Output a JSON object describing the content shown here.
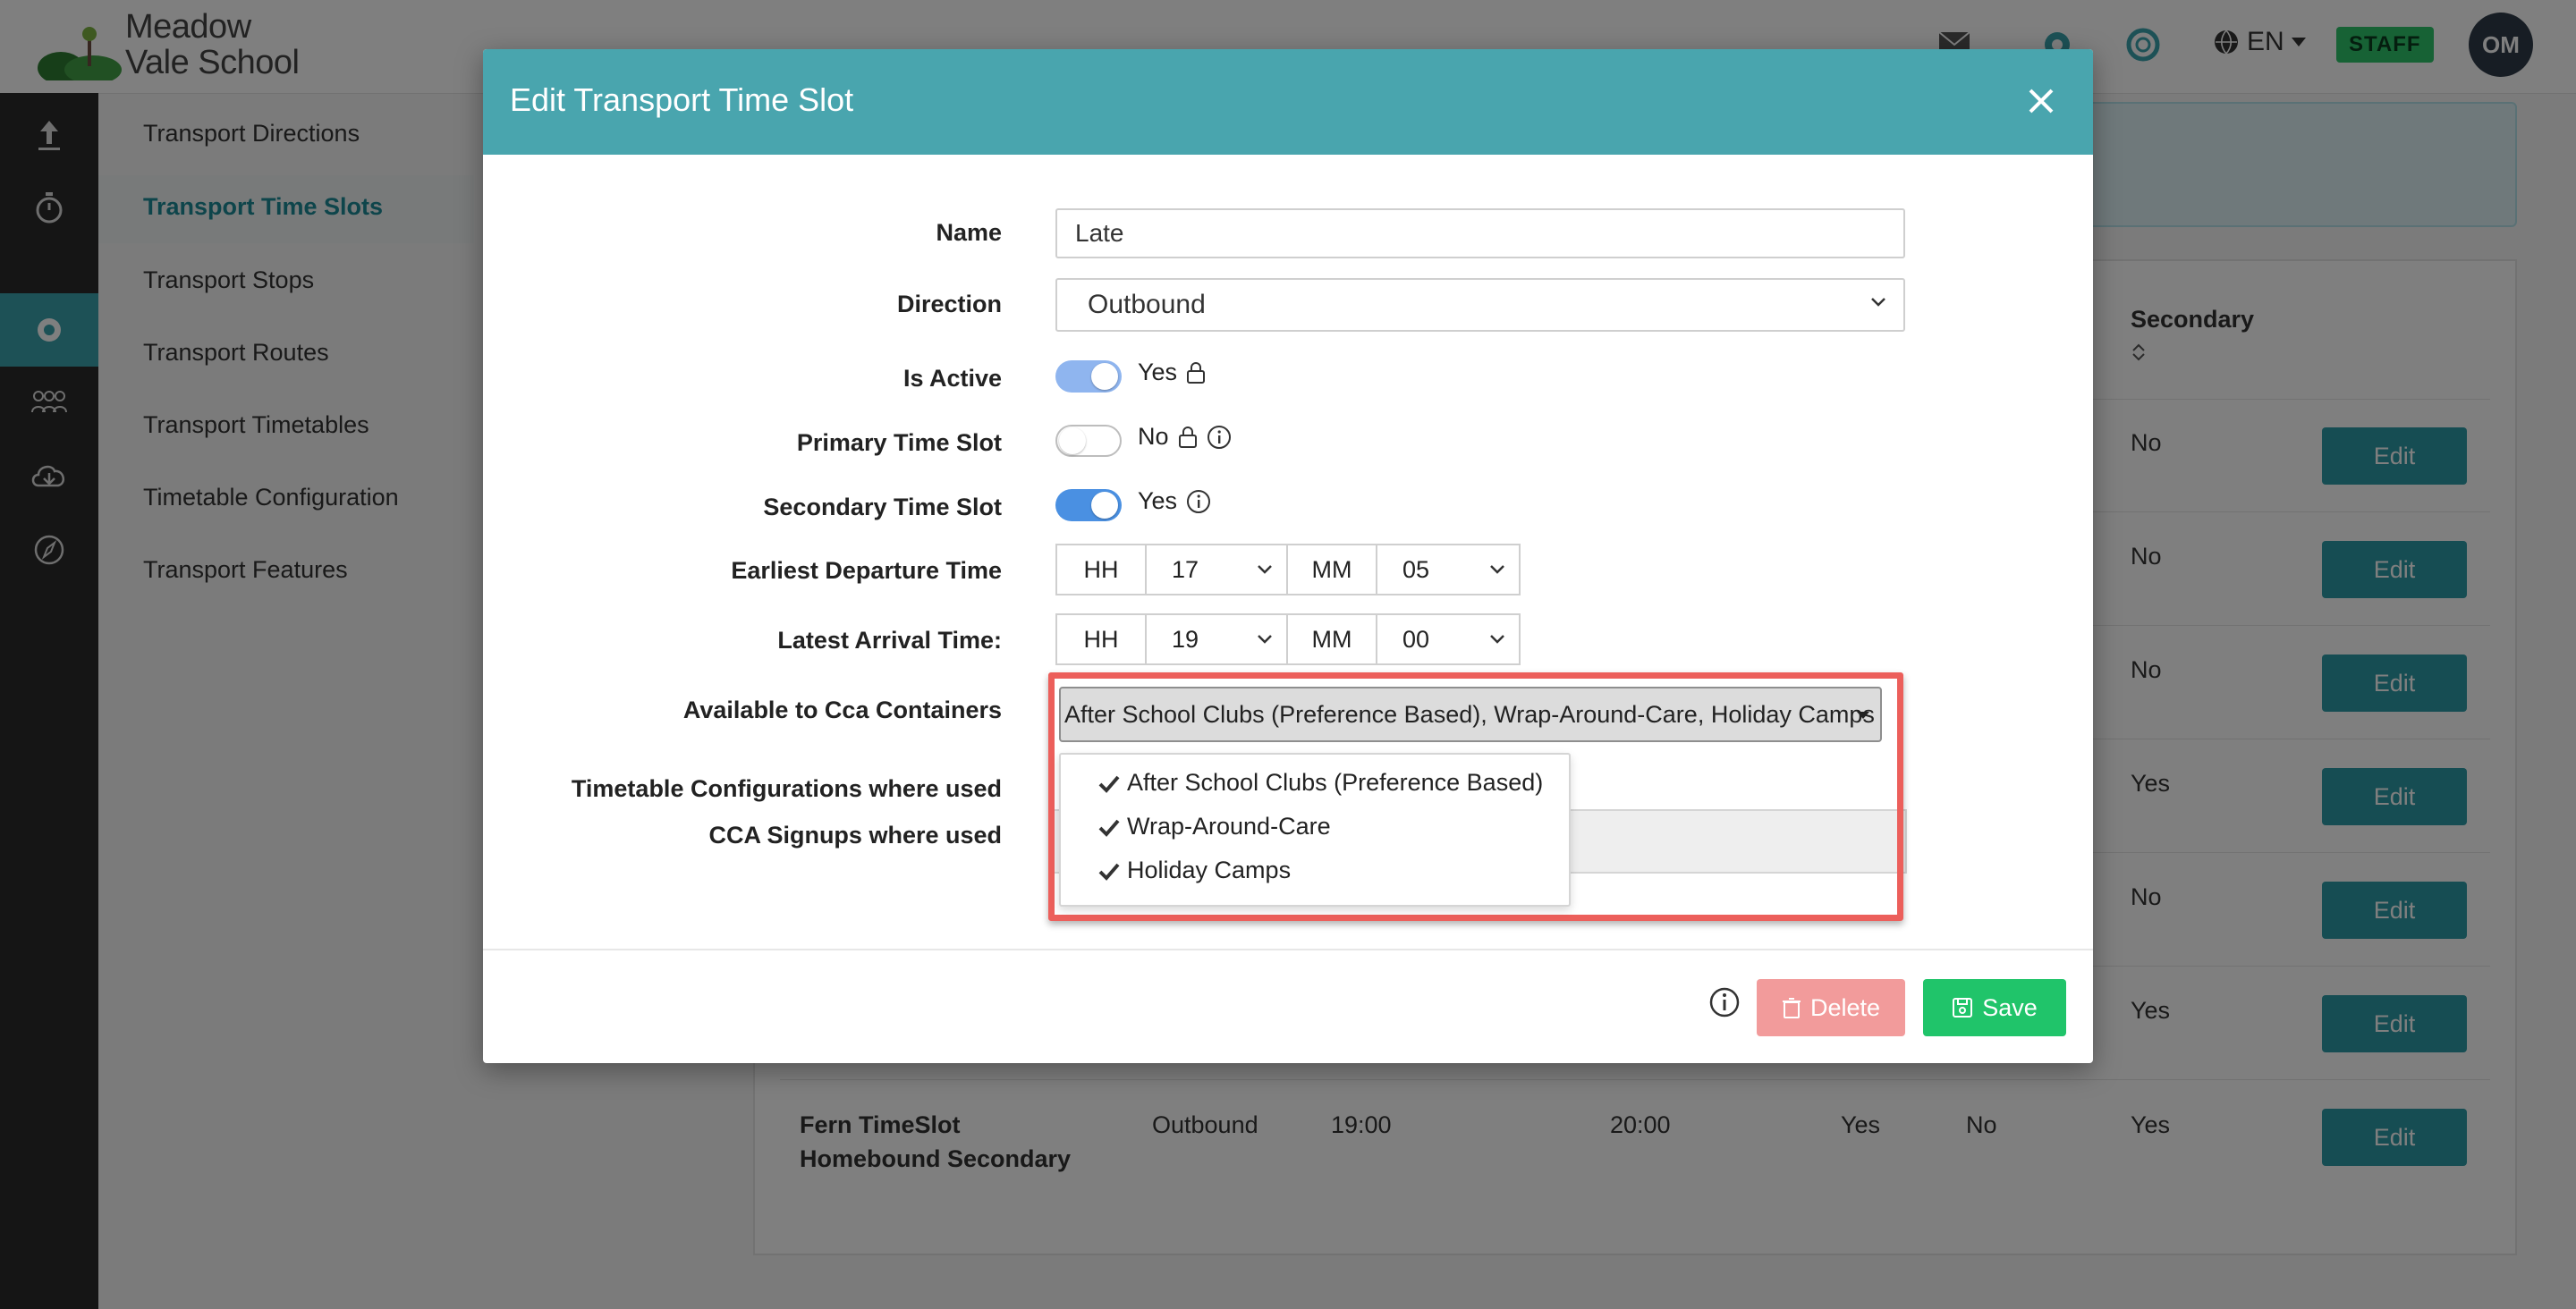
{
  "app": {
    "logo_line1": "Meadow",
    "logo_line2": "Vale School",
    "language": "EN",
    "staff_badge": "STAFF",
    "avatar_initials": "OM"
  },
  "subnav": {
    "items": [
      {
        "label": "Transport Directions"
      },
      {
        "label": "Transport Time Slots",
        "active": true
      },
      {
        "label": "Transport Stops"
      },
      {
        "label": "Transport Routes"
      },
      {
        "label": "Transport Timetables"
      },
      {
        "label": "Timetable Configuration"
      },
      {
        "label": "Transport Features"
      }
    ]
  },
  "table": {
    "secondary_header": "Secondary",
    "rows": [
      {
        "secondary": "No",
        "edit": "Edit"
      },
      {
        "secondary": "No",
        "edit": "Edit"
      },
      {
        "secondary": "No",
        "edit": "Edit"
      },
      {
        "secondary": "Yes",
        "edit": "Edit"
      },
      {
        "secondary": "No",
        "edit": "Edit"
      },
      {
        "secondary": "Yes",
        "edit": "Edit"
      },
      {
        "name_line1": "Fern TimeSlot",
        "name_line2": "Homebound Secondary",
        "direction": "Outbound",
        "departure": "19:00",
        "arrival": "20:00",
        "active": "Yes",
        "primary": "No",
        "secondary": "Yes",
        "edit": "Edit"
      }
    ]
  },
  "modal": {
    "title": "Edit Transport Time Slot",
    "name_label": "Name",
    "name_value": "Late",
    "direction_label": "Direction",
    "direction_value": "Outbound",
    "is_active_label": "Is Active",
    "is_active_value": "Yes",
    "primary_label": "Primary Time Slot",
    "primary_value": "No",
    "secondary_label": "Secondary Time Slot",
    "secondary_value": "Yes",
    "earliest_label": "Earliest Departure Time",
    "earliest_hh_addon": "HH",
    "earliest_hh": "17",
    "earliest_mm_addon": "MM",
    "earliest_mm": "05",
    "latest_label": "Latest Arrival Time:",
    "latest_hh_addon": "HH",
    "latest_hh": "19",
    "latest_mm_addon": "MM",
    "latest_mm": "00",
    "cca_label": "Available to Cca Containers",
    "cca_selected": "After School Clubs (Preference Based), Wrap-Around-Care, Holiday Camps",
    "cca_options": [
      {
        "label": "After School Clubs (Preference Based)",
        "checked": true
      },
      {
        "label": "Wrap-Around-Care",
        "checked": true
      },
      {
        "label": "Holiday Camps",
        "checked": true
      }
    ],
    "timetable_label": "Timetable Configurations where used",
    "signups_label": "CCA Signups where used",
    "delete_label": "Delete",
    "save_label": "Save"
  },
  "colors": {
    "header_teal": "#49a5ae",
    "accent_teal": "#2c9aa6",
    "highlight_red": "#ec5f5b",
    "save_green": "#20c46a",
    "delete_pink": "#f29b9b"
  }
}
